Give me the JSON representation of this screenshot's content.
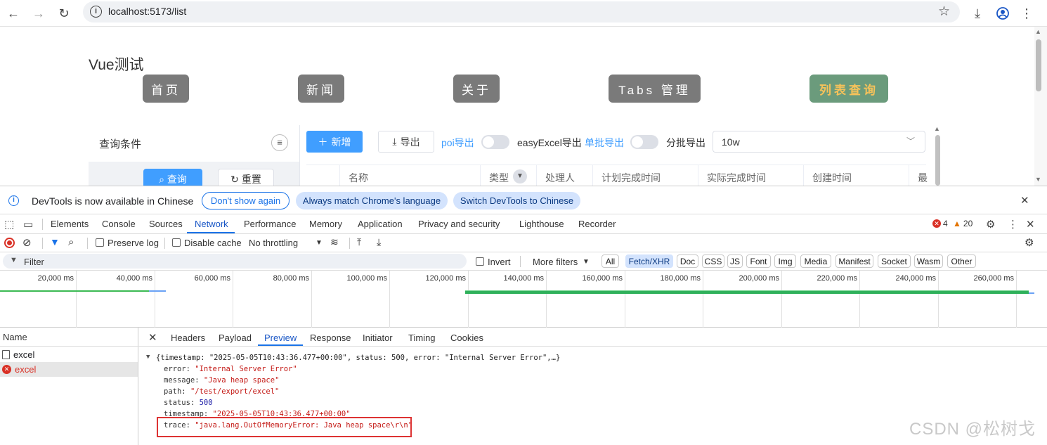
{
  "browser": {
    "url": "localhost:5173/list"
  },
  "app": {
    "title": "Vue测试",
    "nav_tabs": [
      "首页",
      "新闻",
      "关于",
      "Tabs 管理",
      "列表查询"
    ],
    "query_label": "查询条件",
    "query_button": "查询",
    "reset_button": "重置",
    "toolbar": {
      "add": "新增",
      "export": "导出",
      "poi_export": "poi导出",
      "easyexcel_export": "easyExcel导出",
      "batch_export": "单批导出",
      "split_export": "分批导出",
      "size_value": "10w"
    },
    "table_headers": [
      "名称",
      "类型",
      "处理人",
      "计划完成时间",
      "实际完成时间",
      "创建时间",
      "最"
    ]
  },
  "infobar": {
    "message": "DevTools is now available in Chinese",
    "dont_show": "Don't show again",
    "always_match": "Always match Chrome's language",
    "switch": "Switch DevTools to Chinese"
  },
  "devtools": {
    "tabs": [
      "Elements",
      "Console",
      "Sources",
      "Network",
      "Performance",
      "Memory",
      "Application",
      "Privacy and security",
      "Lighthouse",
      "Recorder"
    ],
    "active_tab": "Network",
    "error_count": "4",
    "warning_count": "20",
    "network_toolbar": {
      "preserve_log": "Preserve log",
      "disable_cache": "Disable cache",
      "throttling": "No throttling"
    },
    "filter": {
      "placeholder": "Filter",
      "invert": "Invert",
      "more_filters": "More filters",
      "chips": [
        "All",
        "Fetch/XHR",
        "Doc",
        "CSS",
        "JS",
        "Font",
        "Img",
        "Media",
        "Manifest",
        "Socket",
        "Wasm",
        "Other"
      ],
      "active_chip": "Fetch/XHR"
    },
    "timeline_ticks": [
      "20,000 ms",
      "40,000 ms",
      "60,000 ms",
      "80,000 ms",
      "100,000 ms",
      "120,000 ms",
      "140,000 ms",
      "160,000 ms",
      "180,000 ms",
      "200,000 ms",
      "220,000 ms",
      "240,000 ms",
      "260,000 ms"
    ],
    "request_list": {
      "header": "Name",
      "rows": [
        "excel",
        "excel"
      ]
    },
    "detail_tabs": [
      "Headers",
      "Payload",
      "Preview",
      "Response",
      "Initiator",
      "Timing",
      "Cookies"
    ],
    "active_detail_tab": "Preview",
    "preview": {
      "summary": "{timestamp: \"2025-05-05T10:43:36.477+00:00\", status: 500, error: \"Internal Server Error\",…}",
      "fields": [
        {
          "key": "error",
          "value": "\"Internal Server Error\"",
          "kind": "str"
        },
        {
          "key": "message",
          "value": "\"Java heap space\"",
          "kind": "str"
        },
        {
          "key": "path",
          "value": "\"/test/export/excel\"",
          "kind": "str"
        },
        {
          "key": "status",
          "value": "500",
          "kind": "num"
        },
        {
          "key": "timestamp",
          "value": "\"2025-05-05T10:43:36.477+00:00\"",
          "kind": "str"
        },
        {
          "key": "trace",
          "value": "\"java.lang.OutOfMemoryError: Java heap space\\r\\n\"",
          "kind": "str"
        }
      ]
    }
  },
  "watermark": "CSDN @松树戈",
  "colors": {
    "accent": "#1a73e8",
    "error": "#d93025",
    "active_nav_bg": "#6b9b7c",
    "active_nav_text": "#f6c25a",
    "primary_button": "#409eff"
  }
}
